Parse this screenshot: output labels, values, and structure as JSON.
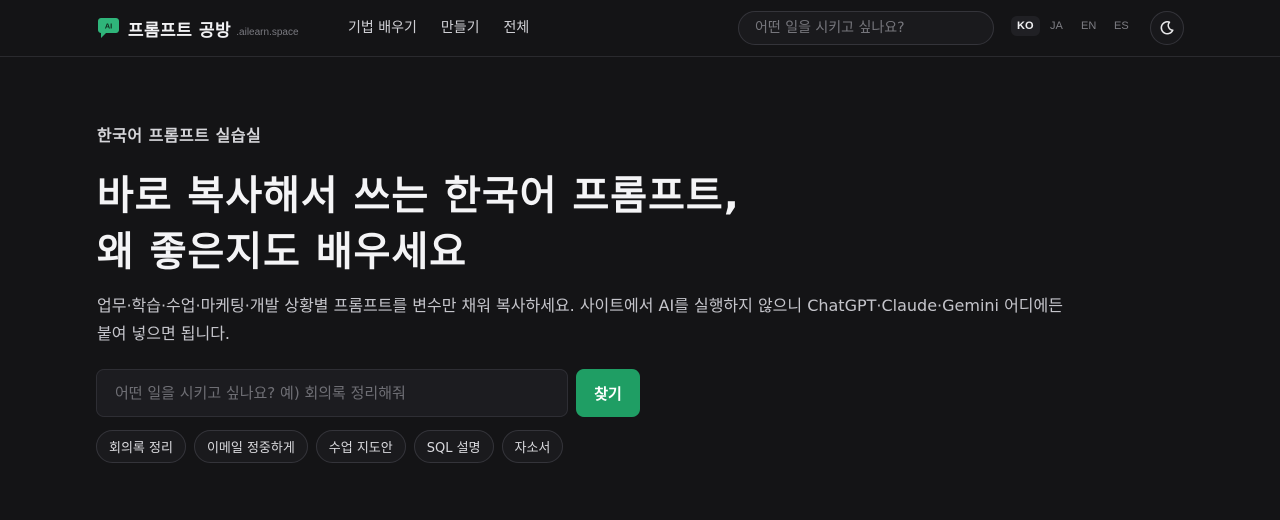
{
  "header": {
    "brand": "프롬프트 공방",
    "domain": ".ailearn.space",
    "nav": [
      "기법 배우기",
      "만들기",
      "전체"
    ],
    "search_placeholder": "어떤 일을 시키고 싶나요?",
    "languages": [
      "KO",
      "JA",
      "EN",
      "ES"
    ],
    "active_language": "KO",
    "theme_icon": "moon-icon"
  },
  "hero": {
    "kicker": "한국어 프롬프트 실습실",
    "title_line1": "바로 복사해서 쓰는 한국어 프롬프트,",
    "title_line2": "왜 좋은지도 배우세요",
    "subtitle_line1": "업무·학습·수업·마케팅·개발 상황별 프롬프트를 변수만 채워 복사하세요. 사이트에서 AI를 실행하지 않으니 ChatGPT·Claude·Gemini 어디에든",
    "subtitle_line2": "붙여 넣으면 됩니다.",
    "search_placeholder": "어떤 일을 시키고 싶나요? 예) 회의록 정리해줘",
    "search_button": "찾기",
    "chips": [
      "회의록 정리",
      "이메일 정중하게",
      "수업 지도안",
      "SQL 설명",
      "자소서"
    ]
  },
  "colors": {
    "background": "#141416",
    "accent": "#1f9e64",
    "logo": "#2fb57a"
  }
}
